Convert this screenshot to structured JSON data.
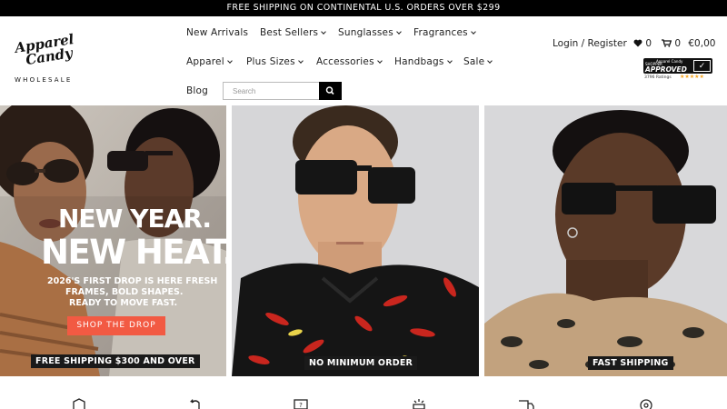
{
  "announcement": "FREE SHIPPING ON CONTINENTAL U.S. ORDERS OVER $299",
  "logo": {
    "script_line1": "Apparel",
    "script_line2": "Candy",
    "sub": "WHOLESALE"
  },
  "nav": {
    "new_arrivals": "New Arrivals",
    "best_sellers": "Best Sellers",
    "sunglasses": "Sunglasses",
    "fragrances": "Fragrances",
    "apparel": "Apparel",
    "plus_sizes": "Plus Sizes",
    "accessories": "Accessories",
    "handbags": "Handbags",
    "sale": "Sale",
    "blog": "Blog"
  },
  "search": {
    "placeholder": "Search"
  },
  "account": {
    "login_register": "Login / Register",
    "wishlist_count": "0",
    "cart_count": "0",
    "cart_total": "€0,00"
  },
  "badge": {
    "top": "Apparel Candy",
    "mid": "SHOPPER",
    "main": "APPROVED",
    "ratings": "3796 Ratings",
    "stars": "★★★★★"
  },
  "hero": {
    "panel1": {
      "headline1": "NEW YEAR.",
      "headline2": "NEW HEAT.",
      "sub1": "2026'S FIRST DROP IS HERE FRESH",
      "sub2": "FRAMES, BOLD SHAPES.",
      "sub3": "READY TO MOVE FAST.",
      "button": "SHOP THE DROP",
      "tag": "FREE SHIPPING $300 AND OVER"
    },
    "panel2": {
      "tag": "NO MINIMUM ORDER"
    },
    "panel3": {
      "tag": "FAST SHIPPING"
    }
  },
  "colors": {
    "accent": "#f25a43",
    "topbar": "#000000",
    "stars": "#f5a623"
  }
}
